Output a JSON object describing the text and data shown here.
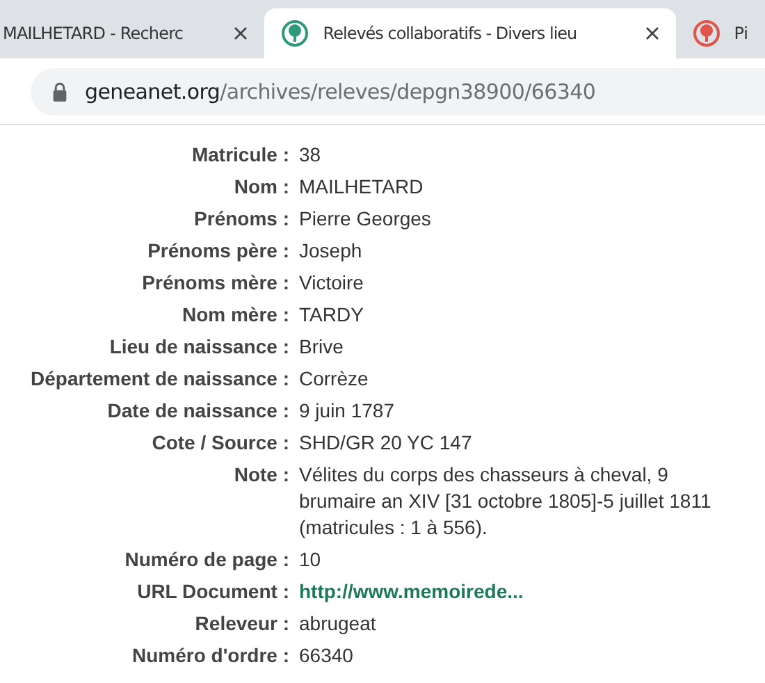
{
  "tabs": [
    {
      "title": "MAILHETARD - Recherc",
      "selected": false,
      "closable": true
    },
    {
      "title": "Relevés collaboratifs - Divers lieu",
      "color": "#2e9a7a",
      "selected": true,
      "closable": true
    },
    {
      "title": "Pi",
      "color": "#e0544b",
      "selected": false,
      "closable": false
    }
  ],
  "address_bar": {
    "domain": "geneanet.org",
    "path": "/archives/releves/depgn38900/66340"
  },
  "record": [
    {
      "label": "Matricule :",
      "value": "38",
      "kind": "text"
    },
    {
      "label": "Nom :",
      "value": "MAILHETARD",
      "kind": "text"
    },
    {
      "label": "Prénoms :",
      "value": "Pierre Georges",
      "kind": "text"
    },
    {
      "label": "Prénoms père :",
      "value": "Joseph",
      "kind": "text"
    },
    {
      "label": "Prénoms mère :",
      "value": "Victoire",
      "kind": "text"
    },
    {
      "label": "Nom mère :",
      "value": "TARDY",
      "kind": "text"
    },
    {
      "label": "Lieu de naissance :",
      "value": "Brive",
      "kind": "text"
    },
    {
      "label": "Département de naissance :",
      "value": "Corrèze",
      "kind": "text"
    },
    {
      "label": "Date de naissance :",
      "value": "9 juin 1787",
      "kind": "text"
    },
    {
      "label": "Cote / Source :",
      "value": "SHD/GR 20 YC 147",
      "kind": "text"
    },
    {
      "label": "Note :",
      "value": "Vélites du corps des chasseurs à cheval, 9 brumaire an XIV [31 octobre 1805]-5 juillet 1811 (matricules : 1 à 556).",
      "kind": "text"
    },
    {
      "label": "Numéro de page :",
      "value": "10",
      "kind": "text"
    },
    {
      "label": "URL Document :",
      "value": "http://www.memoirede...",
      "kind": "link"
    },
    {
      "label": "Releveur :",
      "value": "abrugeat",
      "kind": "text"
    },
    {
      "label": "Numéro d'ordre :",
      "value": "66340",
      "kind": "text"
    }
  ]
}
